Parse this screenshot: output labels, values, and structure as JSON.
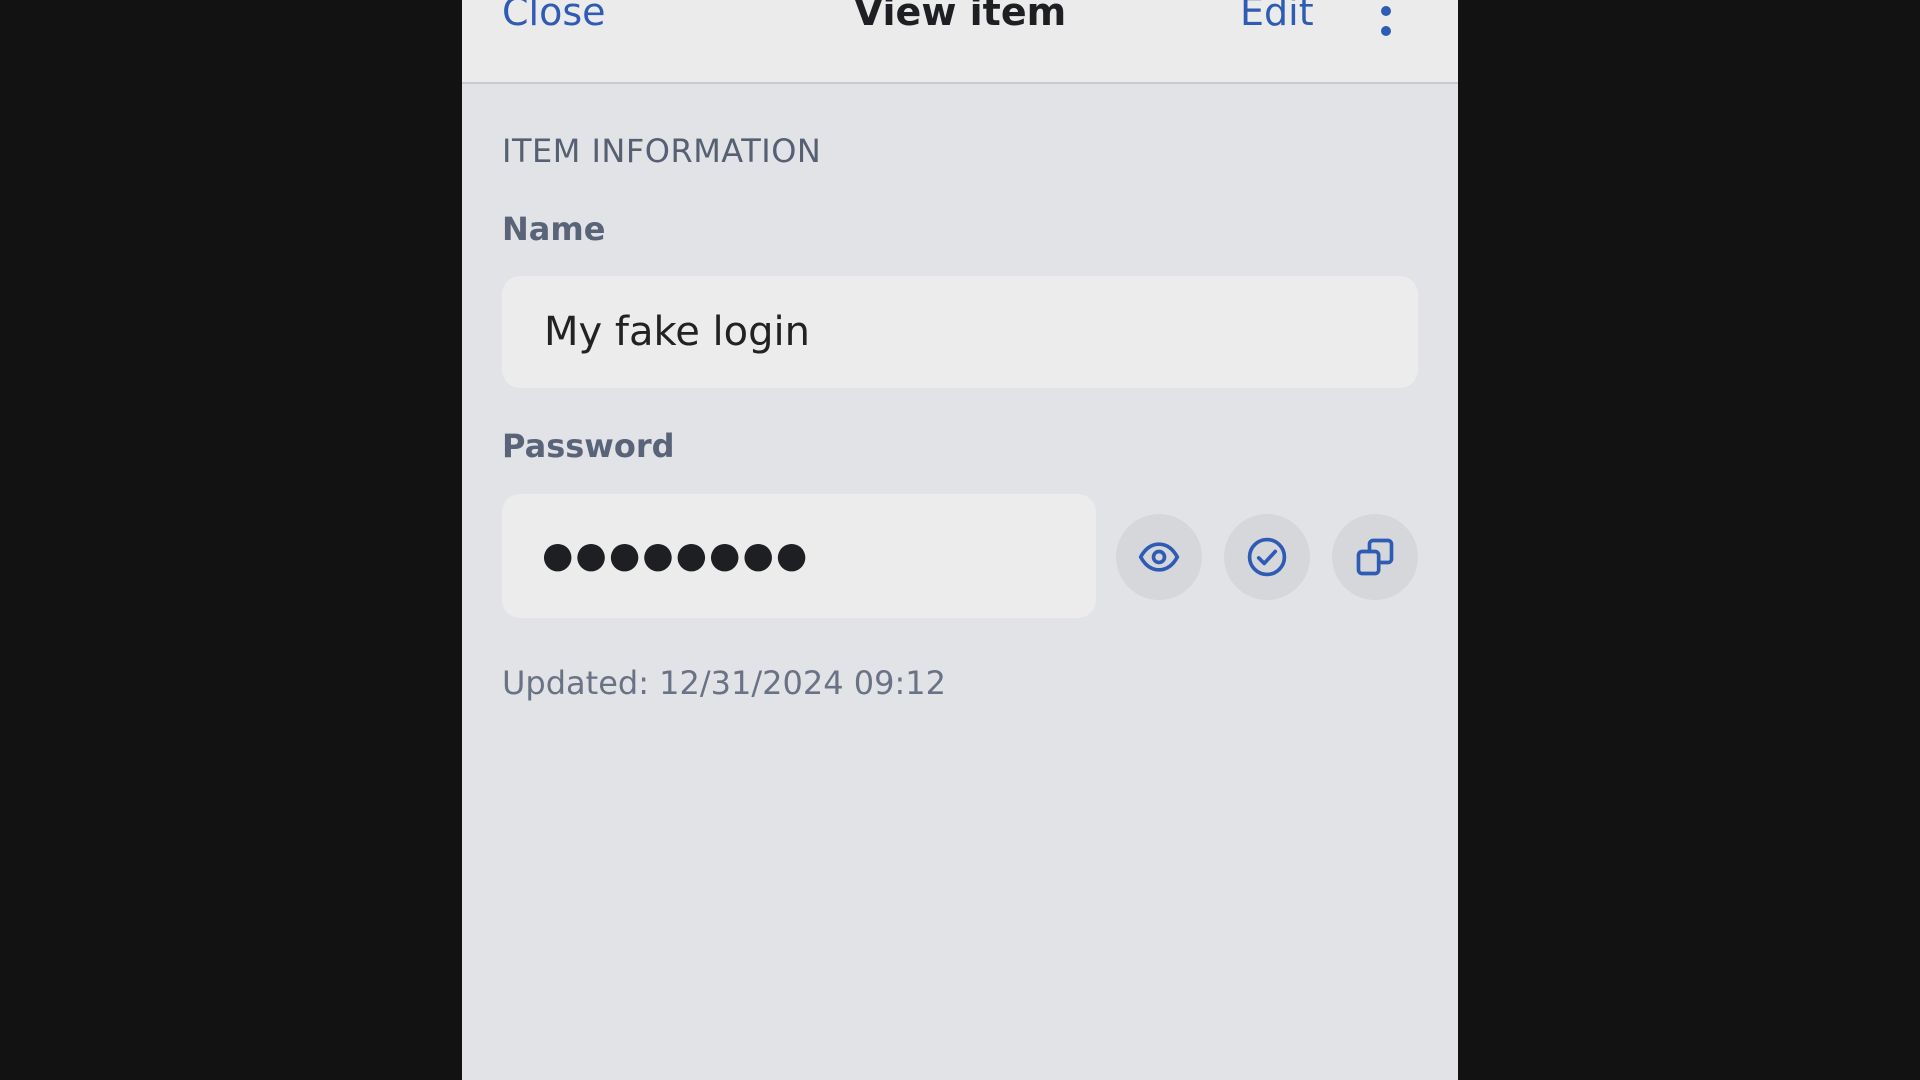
{
  "nav": {
    "close_label": "Close",
    "title": "View item",
    "edit_label": "Edit",
    "more_icon": "more-vertical-icon"
  },
  "section": {
    "header": "ITEM INFORMATION"
  },
  "fields": {
    "name_label": "Name",
    "name_value": "My fake login",
    "password_label": "Password",
    "password_masked": "●●●●●●●●"
  },
  "actions": {
    "toggle_visibility_icon": "eye-icon",
    "check_password_icon": "check-circle-icon",
    "copy_icon": "copy-icon"
  },
  "meta": {
    "updated": "Updated: 12/31/2024 09:12"
  },
  "colors": {
    "accent": "#2e5bb3",
    "background": "#e1e3e7",
    "outer": "#121212"
  }
}
